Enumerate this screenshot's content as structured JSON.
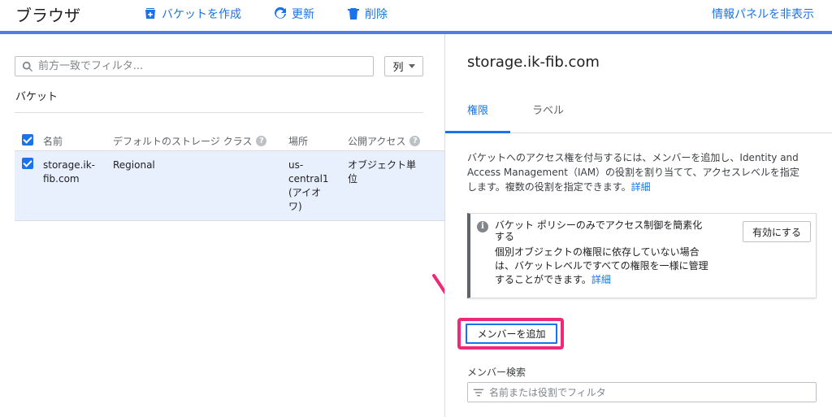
{
  "header": {
    "title": "ブラウザ",
    "create_bucket": "バケットを作成",
    "refresh": "更新",
    "delete": "削除",
    "hide_info_panel": "情報パネルを非表示"
  },
  "browser": {
    "filter_placeholder": "前方一致でフィルタ...",
    "columns_button": "列",
    "section_label": "バケット",
    "table": {
      "headers": [
        "名前",
        "デフォルトのストレージ クラス",
        "場所",
        "公開アクセス"
      ],
      "rows": [
        {
          "name_line1": "storage.ik-",
          "name_line2": "fib.com",
          "storage_class": "Regional",
          "location_line1": "us-",
          "location_line2": "central1",
          "location_line3": "(アイオ",
          "location_line4": "ワ)",
          "public_access_line1": "オブジェクト単",
          "public_access_line2": "位"
        }
      ]
    }
  },
  "info_panel": {
    "title": "storage.ik-fib.com",
    "tabs": [
      "権限",
      "ラベル"
    ],
    "description_line1": "バケットへのアクセス権を付与するには、メンバーを追加し、Identity and",
    "description_line2": "Access Management（IAM）の役割を割り当てて、アクセスレベルを指定",
    "description_line3": "します。複数の役割を指定できます。",
    "description_link": "詳細",
    "notice": {
      "title_line1": "バケット ポリシーのみでアクセス制御を簡素化",
      "title_line2": "する",
      "body_line1": "個別オブジェクトの権限に依存していない場合",
      "body_line2": "は、バケットレベルですべての権限を一様に管理",
      "body_line3": "することができます。",
      "link": "詳細",
      "button": "有効にする"
    },
    "add_member_button": "メンバーを追加",
    "member_search_label": "メンバー検索",
    "member_filter_placeholder": "名前または役割でフィルタ"
  },
  "colors": {
    "accent": "#1a73e8",
    "header_bar": "#4a7ee0",
    "highlight": "#f0287a",
    "selected_row": "#e8f0fe"
  }
}
